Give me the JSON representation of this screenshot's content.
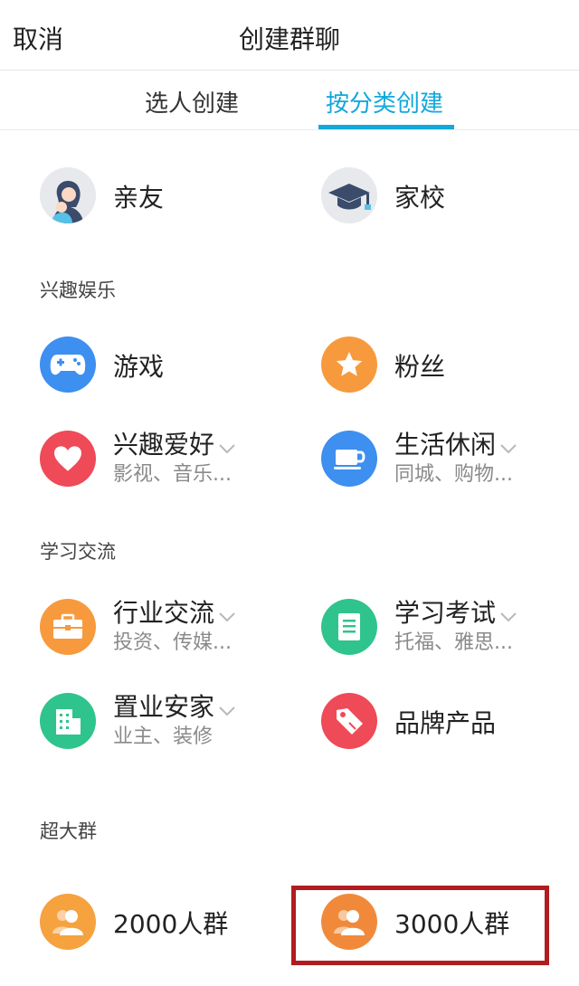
{
  "header": {
    "cancel_label": "取消",
    "title": "创建群聊"
  },
  "tabs": [
    {
      "label": "选人创建",
      "active": false
    },
    {
      "label": "按分类创建",
      "active": true
    }
  ],
  "colors": {
    "accent": "#12a8dc",
    "highlight_border": "#b01c20",
    "orange": "#f79a3d",
    "blue": "#3d8ff0",
    "red": "#ef4a57",
    "green": "#2fc48d",
    "gray": "#e7e9ec"
  },
  "top_items": [
    {
      "label": "亲友",
      "icon": "family-icon"
    },
    {
      "label": "家校",
      "icon": "graduation-cap-icon"
    }
  ],
  "sections": [
    {
      "label": "兴趣娱乐",
      "items": [
        {
          "label": "游戏",
          "icon": "gamepad-icon"
        },
        {
          "label": "粉丝",
          "icon": "star-icon"
        },
        {
          "label": "兴趣爱好",
          "sub": "影视、音乐...",
          "icon": "heart-icon",
          "has_dropdown": true
        },
        {
          "label": "生活休闲",
          "sub": "同城、购物...",
          "icon": "coffee-cup-icon",
          "has_dropdown": true
        }
      ]
    },
    {
      "label": "学习交流",
      "items": [
        {
          "label": "行业交流",
          "sub": "投资、传媒...",
          "icon": "briefcase-icon",
          "has_dropdown": true
        },
        {
          "label": "学习考试",
          "sub": "托福、雅思...",
          "icon": "document-icon",
          "has_dropdown": true
        },
        {
          "label": "置业安家",
          "sub": "业主、装修",
          "icon": "building-icon",
          "has_dropdown": true
        },
        {
          "label": "品牌产品",
          "icon": "price-tag-icon"
        }
      ]
    },
    {
      "label": "超大群",
      "items": [
        {
          "label": "2000人群",
          "icon": "group-icon"
        },
        {
          "label": "3000人群",
          "icon": "group-icon",
          "highlighted": true
        }
      ]
    }
  ]
}
